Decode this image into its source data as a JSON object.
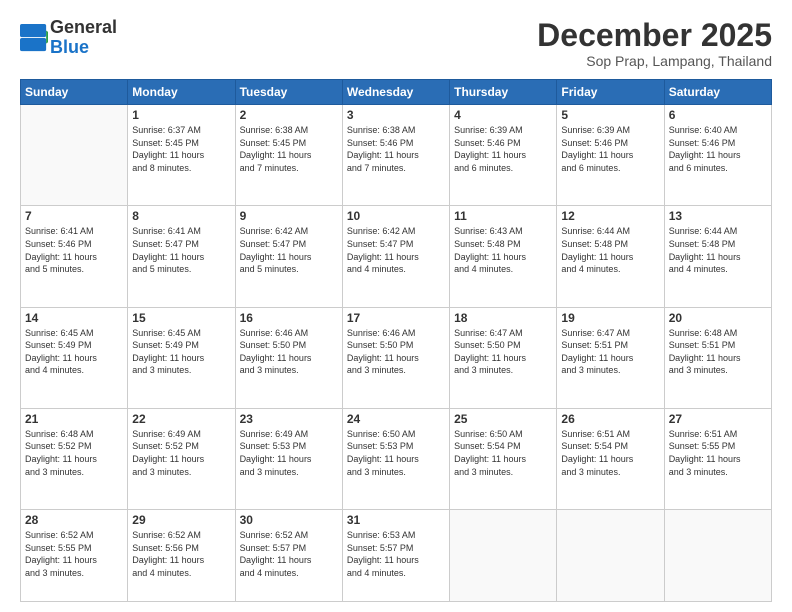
{
  "header": {
    "logo_line1": "General",
    "logo_line2": "Blue",
    "month": "December 2025",
    "location": "Sop Prap, Lampang, Thailand"
  },
  "weekdays": [
    "Sunday",
    "Monday",
    "Tuesday",
    "Wednesday",
    "Thursday",
    "Friday",
    "Saturday"
  ],
  "weeks": [
    [
      {
        "day": "",
        "info": ""
      },
      {
        "day": "1",
        "info": "Sunrise: 6:37 AM\nSunset: 5:45 PM\nDaylight: 11 hours\nand 8 minutes."
      },
      {
        "day": "2",
        "info": "Sunrise: 6:38 AM\nSunset: 5:45 PM\nDaylight: 11 hours\nand 7 minutes."
      },
      {
        "day": "3",
        "info": "Sunrise: 6:38 AM\nSunset: 5:46 PM\nDaylight: 11 hours\nand 7 minutes."
      },
      {
        "day": "4",
        "info": "Sunrise: 6:39 AM\nSunset: 5:46 PM\nDaylight: 11 hours\nand 6 minutes."
      },
      {
        "day": "5",
        "info": "Sunrise: 6:39 AM\nSunset: 5:46 PM\nDaylight: 11 hours\nand 6 minutes."
      },
      {
        "day": "6",
        "info": "Sunrise: 6:40 AM\nSunset: 5:46 PM\nDaylight: 11 hours\nand 6 minutes."
      }
    ],
    [
      {
        "day": "7",
        "info": "Sunrise: 6:41 AM\nSunset: 5:46 PM\nDaylight: 11 hours\nand 5 minutes."
      },
      {
        "day": "8",
        "info": "Sunrise: 6:41 AM\nSunset: 5:47 PM\nDaylight: 11 hours\nand 5 minutes."
      },
      {
        "day": "9",
        "info": "Sunrise: 6:42 AM\nSunset: 5:47 PM\nDaylight: 11 hours\nand 5 minutes."
      },
      {
        "day": "10",
        "info": "Sunrise: 6:42 AM\nSunset: 5:47 PM\nDaylight: 11 hours\nand 4 minutes."
      },
      {
        "day": "11",
        "info": "Sunrise: 6:43 AM\nSunset: 5:48 PM\nDaylight: 11 hours\nand 4 minutes."
      },
      {
        "day": "12",
        "info": "Sunrise: 6:44 AM\nSunset: 5:48 PM\nDaylight: 11 hours\nand 4 minutes."
      },
      {
        "day": "13",
        "info": "Sunrise: 6:44 AM\nSunset: 5:48 PM\nDaylight: 11 hours\nand 4 minutes."
      }
    ],
    [
      {
        "day": "14",
        "info": "Sunrise: 6:45 AM\nSunset: 5:49 PM\nDaylight: 11 hours\nand 4 minutes."
      },
      {
        "day": "15",
        "info": "Sunrise: 6:45 AM\nSunset: 5:49 PM\nDaylight: 11 hours\nand 3 minutes."
      },
      {
        "day": "16",
        "info": "Sunrise: 6:46 AM\nSunset: 5:50 PM\nDaylight: 11 hours\nand 3 minutes."
      },
      {
        "day": "17",
        "info": "Sunrise: 6:46 AM\nSunset: 5:50 PM\nDaylight: 11 hours\nand 3 minutes."
      },
      {
        "day": "18",
        "info": "Sunrise: 6:47 AM\nSunset: 5:50 PM\nDaylight: 11 hours\nand 3 minutes."
      },
      {
        "day": "19",
        "info": "Sunrise: 6:47 AM\nSunset: 5:51 PM\nDaylight: 11 hours\nand 3 minutes."
      },
      {
        "day": "20",
        "info": "Sunrise: 6:48 AM\nSunset: 5:51 PM\nDaylight: 11 hours\nand 3 minutes."
      }
    ],
    [
      {
        "day": "21",
        "info": "Sunrise: 6:48 AM\nSunset: 5:52 PM\nDaylight: 11 hours\nand 3 minutes."
      },
      {
        "day": "22",
        "info": "Sunrise: 6:49 AM\nSunset: 5:52 PM\nDaylight: 11 hours\nand 3 minutes."
      },
      {
        "day": "23",
        "info": "Sunrise: 6:49 AM\nSunset: 5:53 PM\nDaylight: 11 hours\nand 3 minutes."
      },
      {
        "day": "24",
        "info": "Sunrise: 6:50 AM\nSunset: 5:53 PM\nDaylight: 11 hours\nand 3 minutes."
      },
      {
        "day": "25",
        "info": "Sunrise: 6:50 AM\nSunset: 5:54 PM\nDaylight: 11 hours\nand 3 minutes."
      },
      {
        "day": "26",
        "info": "Sunrise: 6:51 AM\nSunset: 5:54 PM\nDaylight: 11 hours\nand 3 minutes."
      },
      {
        "day": "27",
        "info": "Sunrise: 6:51 AM\nSunset: 5:55 PM\nDaylight: 11 hours\nand 3 minutes."
      }
    ],
    [
      {
        "day": "28",
        "info": "Sunrise: 6:52 AM\nSunset: 5:55 PM\nDaylight: 11 hours\nand 3 minutes."
      },
      {
        "day": "29",
        "info": "Sunrise: 6:52 AM\nSunset: 5:56 PM\nDaylight: 11 hours\nand 4 minutes."
      },
      {
        "day": "30",
        "info": "Sunrise: 6:52 AM\nSunset: 5:57 PM\nDaylight: 11 hours\nand 4 minutes."
      },
      {
        "day": "31",
        "info": "Sunrise: 6:53 AM\nSunset: 5:57 PM\nDaylight: 11 hours\nand 4 minutes."
      },
      {
        "day": "",
        "info": ""
      },
      {
        "day": "",
        "info": ""
      },
      {
        "day": "",
        "info": ""
      }
    ]
  ]
}
